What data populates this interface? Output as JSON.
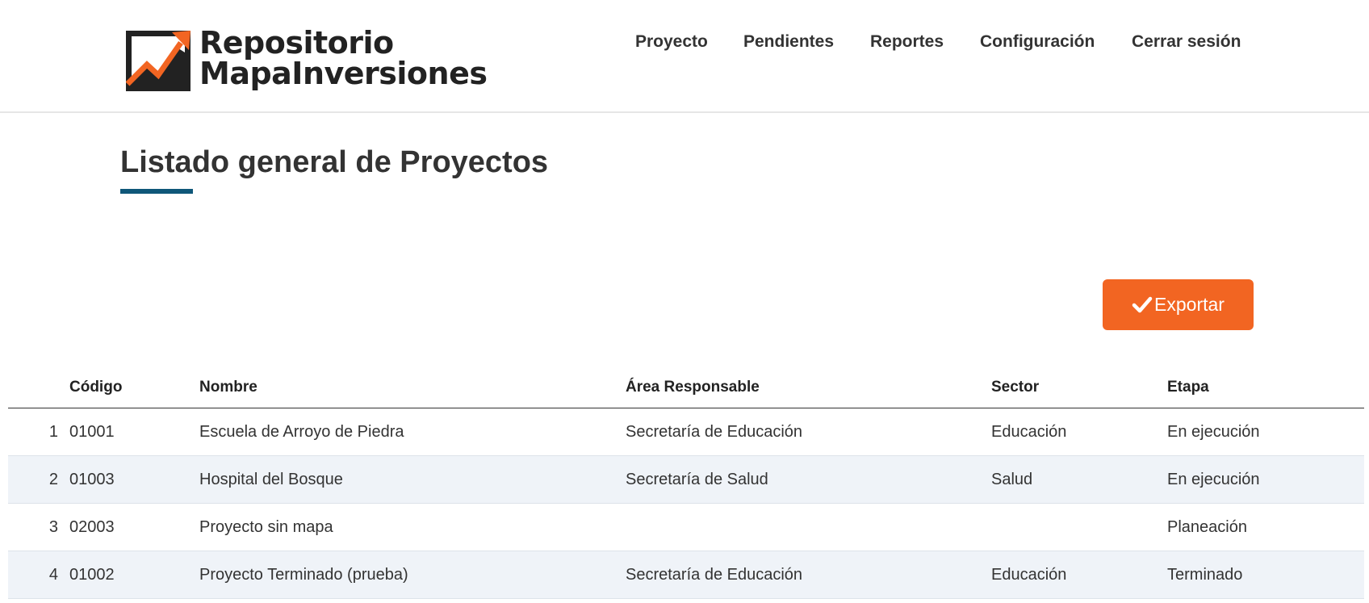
{
  "header": {
    "brand_line1": "Repositorio",
    "brand_line2": "MapaInversiones",
    "nav": [
      {
        "label": "Proyecto"
      },
      {
        "label": "Pendientes"
      },
      {
        "label": "Reportes"
      },
      {
        "label": "Configuración"
      },
      {
        "label": "Cerrar sesión"
      }
    ]
  },
  "main": {
    "title": "Listado general de Proyectos",
    "export_label": "Exportar"
  },
  "table": {
    "columns": [
      "Código",
      "Nombre",
      "Área Responsable",
      "Sector",
      "Etapa"
    ],
    "rows": [
      {
        "index": "1",
        "code": "01001",
        "name": "Escuela de Arroyo de Piedra",
        "area": "Secretaría de Educación",
        "sector": "Educación",
        "stage": "En ejecución"
      },
      {
        "index": "2",
        "code": "01003",
        "name": "Hospital del Bosque",
        "area": "Secretaría de Salud",
        "sector": "Salud",
        "stage": "En ejecución"
      },
      {
        "index": "3",
        "code": "02003",
        "name": "Proyecto sin mapa",
        "area": "",
        "sector": "",
        "stage": "Planeación"
      },
      {
        "index": "4",
        "code": "01002",
        "name": "Proyecto Terminado (prueba)",
        "area": "Secretaría de Educación",
        "sector": "Educación",
        "stage": "Terminado"
      }
    ]
  },
  "colors": {
    "accent": "#f26522",
    "title_underline": "#0f5779",
    "row_alt": "#eff3f8"
  }
}
